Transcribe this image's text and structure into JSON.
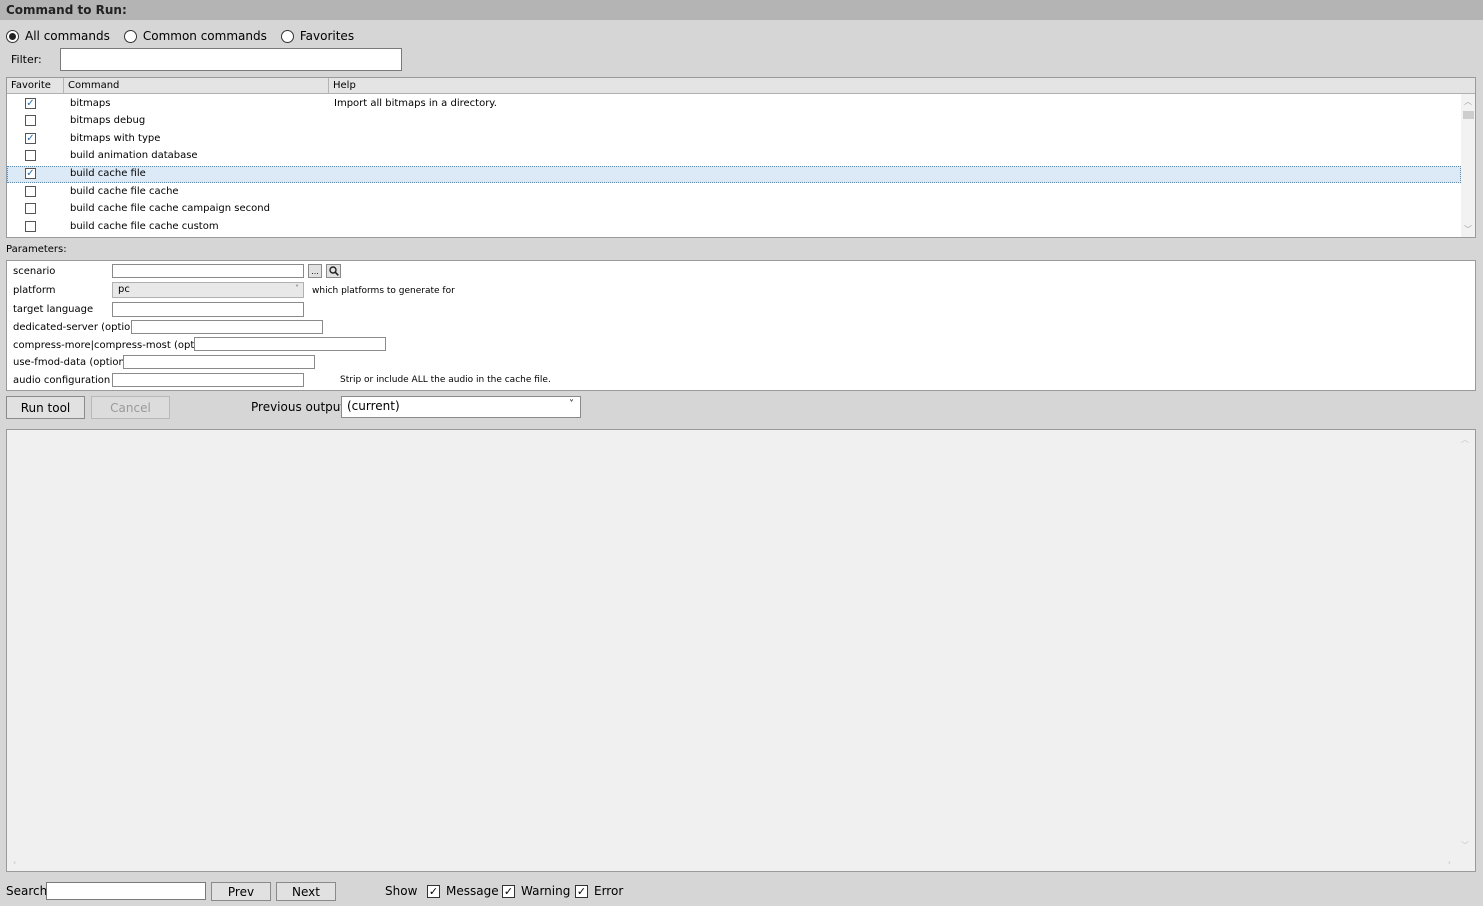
{
  "header": {
    "title": "Command to Run:"
  },
  "command_filter": {
    "radios": [
      {
        "label": "All commands",
        "selected": true
      },
      {
        "label": "Common commands",
        "selected": false
      },
      {
        "label": "Favorites",
        "selected": false
      }
    ],
    "filter_label": "Filter:",
    "filter_value": ""
  },
  "command_list": {
    "columns": [
      "Favorite",
      "Command",
      "Help"
    ],
    "rows": [
      {
        "favorite": true,
        "command": "bitmaps",
        "help": "Import all bitmaps in a directory."
      },
      {
        "favorite": false,
        "command": "bitmaps debug",
        "help": ""
      },
      {
        "favorite": true,
        "command": "bitmaps with type",
        "help": ""
      },
      {
        "favorite": false,
        "command": "build animation database",
        "help": ""
      },
      {
        "favorite": true,
        "command": "build cache file",
        "help": "",
        "selected": true
      },
      {
        "favorite": false,
        "command": "build cache file cache",
        "help": ""
      },
      {
        "favorite": false,
        "command": "build cache file cache campaign second",
        "help": ""
      },
      {
        "favorite": false,
        "command": "build cache file cache custom",
        "help": ""
      }
    ]
  },
  "parameters": {
    "label": "Parameters:",
    "scenario_label": "scenario",
    "scenario_value": "",
    "browse_label": "...",
    "platform_label": "platform",
    "platform_value": "pc",
    "platform_help": "which platforms to generate for",
    "target_language_label": "target language",
    "dedicated_server_label": "dedicated-server (optional)",
    "compress_label": "compress-more|compress-most (optional)",
    "fmod_label": "use-fmod-data (optional)",
    "audio_label": "audio configuration",
    "audio_help": "Strip or include ALL the audio in the cache file."
  },
  "actions": {
    "run_label": "Run tool",
    "cancel_label": "Cancel",
    "previous_output_label": "Previous output:",
    "previous_output_value": "(current)"
  },
  "footer": {
    "search_label": "Search",
    "search_value": "",
    "prev_label": "Prev",
    "next_label": "Next",
    "show_label": "Show",
    "message_label": "Message",
    "warning_label": "Warning",
    "error_label": "Error",
    "message_checked": true,
    "warning_checked": true,
    "error_checked": true
  }
}
